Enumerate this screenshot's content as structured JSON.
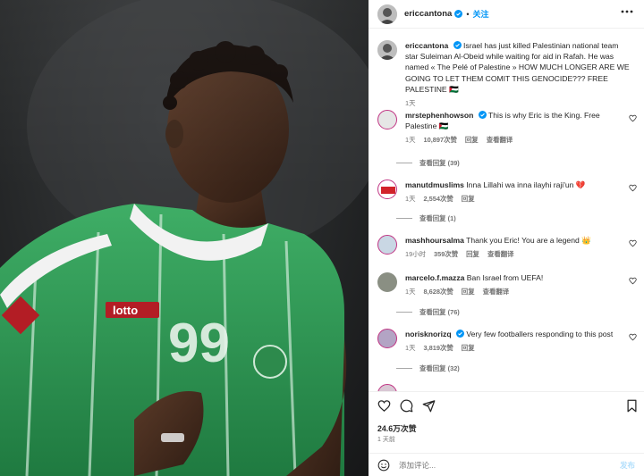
{
  "post": {
    "author": "ericcantona",
    "follow_label": "关注",
    "caption_author": "ericcantona",
    "caption_text": "Israel has just killed Palestinian national team star Suleiman Al-Obeid while waiting for aid in Rafah. He was named « The Pelé of Palestine » HOW MUCH LONGER ARE WE GOING TO LET THEM COMIT THIS GENOCIDE??? FREE PALESTINE 🇵🇸",
    "caption_time": "1天",
    "photo": {
      "jersey_number": "99",
      "sponsor": "Lotto"
    }
  },
  "comments": [
    {
      "username": "mrstephenhowson",
      "verified": true,
      "text": "This is why Eric is the King. Free Palestine 🇵🇸",
      "time": "1天",
      "likes": "10,897次赞",
      "reply": "回复",
      "translate": "查看翻译",
      "view_replies": "查看回复 (39)"
    },
    {
      "username": "manutdmuslims",
      "verified": false,
      "text": "Inna Lillahi wa inna ilayhi raji'un 💔",
      "time": "1天",
      "likes": "2,554次赞",
      "reply": "回复",
      "translate": "",
      "view_replies": "查看回复 (1)"
    },
    {
      "username": "mashhoursalma",
      "verified": false,
      "text": "Thank you Eric! You are a legend 👑",
      "time": "19小时",
      "likes": "359次赞",
      "reply": "回复",
      "translate": "查看翻译",
      "view_replies": ""
    },
    {
      "username": "marcelo.f.mazza",
      "verified": false,
      "text": "Ban Israel from UEFA!",
      "time": "1天",
      "likes": "8,628次赞",
      "reply": "回复",
      "translate": "查看翻译",
      "view_replies": "查看回复 (76)"
    },
    {
      "username": "norisknorizq",
      "verified": true,
      "text": "Very few footballers responding to this post",
      "time": "1天",
      "likes": "3,819次赞",
      "reply": "回复",
      "translate": "",
      "view_replies": "查看回复 (32)"
    }
  ],
  "footer": {
    "likes": "24.6万次赞",
    "date": "1 天前",
    "comment_placeholder": "添加评论...",
    "post_label": "发布"
  },
  "colors": {
    "accent": "#0095f6",
    "verified": "#0095f6",
    "jersey": "#2e9a55"
  },
  "icons": [
    "heart-icon",
    "comment-icon",
    "share-icon",
    "bookmark-icon",
    "emoji-icon",
    "more-icon",
    "verified-icon"
  ]
}
